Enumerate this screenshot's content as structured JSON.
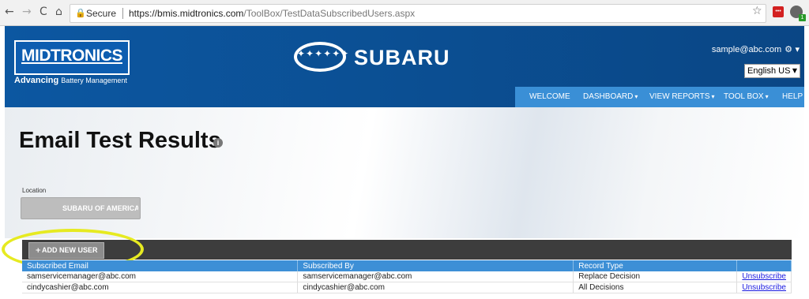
{
  "browser": {
    "back": "←",
    "forward": "→",
    "reload": "C",
    "home": "⌂",
    "lock": "🔒",
    "secure_label": "Secure",
    "url_host": "https://bmis.midtronics.com",
    "url_path": "/ToolBox/TestDataSubscribedUsers.aspx",
    "star": "☆",
    "ext1_text": "•••",
    "ext1_badge": "2",
    "ext2_badge": "1"
  },
  "header": {
    "brand_logo": "MIDTRONICS",
    "tagline_bold": "Advancing",
    "tagline_rest": "Battery Management",
    "partner_logo": "SUBARU",
    "partner_stars": "✦✦✦✦✦✦",
    "user_email": "sample@abc.com",
    "language": "English US",
    "nav": [
      {
        "label": "WELCOME",
        "caret": ""
      },
      {
        "label": "DASHBOARD",
        "caret": "▾"
      },
      {
        "label": "VIEW REPORTS",
        "caret": "▾"
      },
      {
        "label": "TOOL BOX",
        "caret": "▾"
      },
      {
        "label": "HELP",
        "caret": ""
      }
    ]
  },
  "page": {
    "title": "Email Test Results",
    "info_icon": "i",
    "location_label": "Location",
    "location_value": "SUBARU OF AMERICA :"
  },
  "toolbar": {
    "add_label": "ADD NEW USER"
  },
  "table": {
    "headers": [
      "Subscribed Email",
      "Subscribed By",
      "Record Type",
      ""
    ],
    "rows": [
      [
        "samservicemanager@abc.com",
        "samservicemanager@abc.com",
        "Replace Decision",
        "Unsubscribe"
      ],
      [
        "cindycashier@abc.com",
        "cindycashier@abc.com",
        "All Decisions",
        "Unsubscribe"
      ]
    ]
  },
  "colors": {
    "header_blue": "#0b4f93",
    "nav_blue": "#3a8fd6",
    "table_header": "#3d8fd6",
    "highlight": "#e6ea21"
  }
}
